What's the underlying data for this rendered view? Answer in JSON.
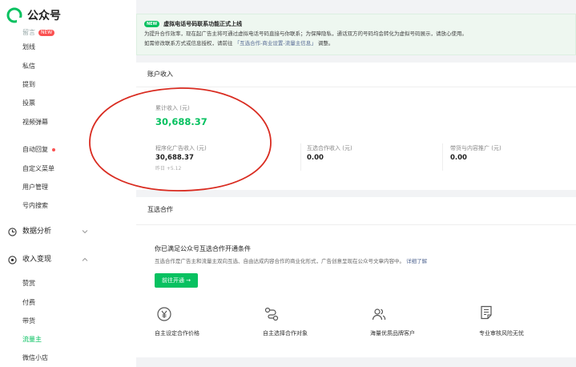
{
  "brand": {
    "name": "公众号",
    "colors": {
      "primary": "#07c160",
      "alert": "#fa5151",
      "link": "#576b95",
      "annotation": "#d92b20"
    }
  },
  "sidebar": {
    "partial_label": "留言",
    "partial_badge": "NEW",
    "items_a": [
      "划线",
      "私信",
      "提到",
      "投票",
      "视频弹幕"
    ],
    "items_b": [
      {
        "label": "自动回复",
        "dot": true
      },
      {
        "label": "自定义菜单"
      },
      {
        "label": "用户管理"
      },
      {
        "label": "号内搜索"
      }
    ],
    "section_analysis": {
      "label": "数据分析",
      "expanded": false
    },
    "section_monetize": {
      "label": "收入变现",
      "expanded": true
    },
    "monetize_items": [
      {
        "label": "赞赏"
      },
      {
        "label": "付费"
      },
      {
        "label": "带货"
      },
      {
        "label": "流量主",
        "active": true
      },
      {
        "label": "微信小店"
      }
    ]
  },
  "notice": {
    "tag": "NEW",
    "title": "虚拟电话号码联系功能正式上线",
    "line1": "为提升合作效率，现在起广告主将可通过虚拟电话号码直接与你联系；为保障隐私，通话双方的号码均会转化为虚拟号码展示，请放心使用。",
    "line2_prefix": "如需修改联系方式或信息授权，请前往",
    "line2_link": "「互选合作-商业设置-流量主信息」",
    "line2_suffix": "调整。"
  },
  "income": {
    "title": "账户收入",
    "total": {
      "label": "累计收入 (元)",
      "value": "30,688.37"
    },
    "programmatic": {
      "label": "程序化广告收入 (元)",
      "value": "30,688.37",
      "yesterday": "昨日 +5.12"
    },
    "mutual": {
      "label": "互选合作收入 (元)",
      "value": "0.00"
    },
    "content_promo": {
      "label": "带货与内容推广 (元)",
      "value": "0.00"
    }
  },
  "cooperation": {
    "title": "互选合作",
    "heading": "你已满足公众号互选合作开通条件",
    "desc": "互选合作是广告主和流量主双向互选、自由达成内容合作的商业化形式，广告创意呈现在公众号文章内容中。",
    "detail_link": "详细了解",
    "open_button": "前往开通 →",
    "features": [
      {
        "icon": "yuan-price-icon",
        "label": "自主设定合作价格"
      },
      {
        "icon": "route-select-icon",
        "label": "自主选择合作对象"
      },
      {
        "icon": "users-icon",
        "label": "海量优质品牌客户"
      },
      {
        "icon": "document-audit-icon",
        "label": "专业审核风险无忧"
      }
    ]
  }
}
